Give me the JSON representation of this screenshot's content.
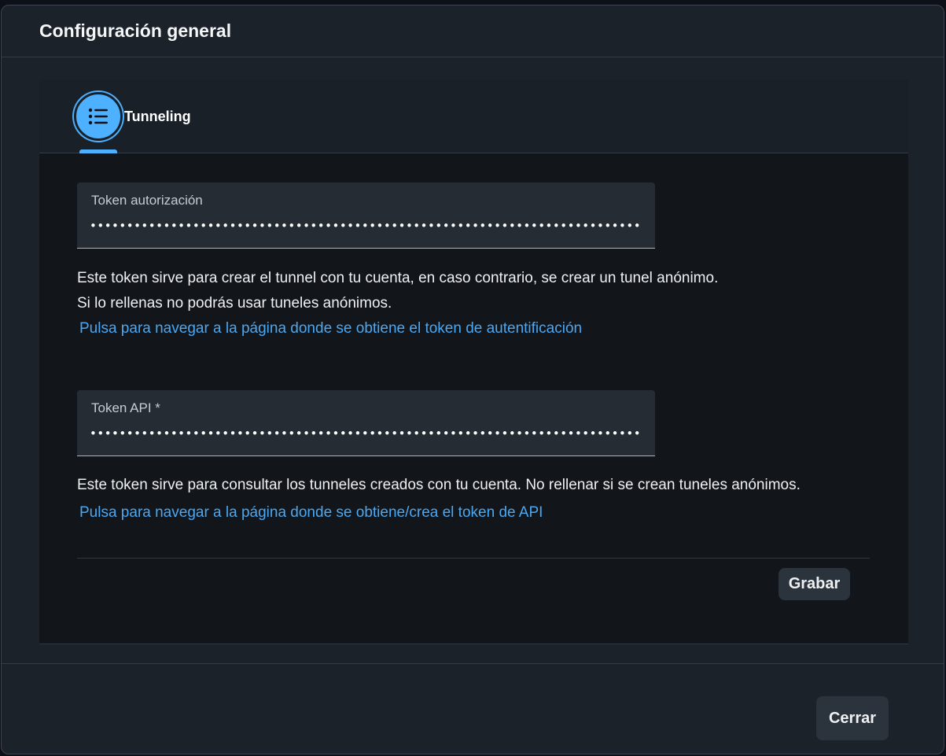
{
  "dialog": {
    "title": "Configuración general"
  },
  "tabs": [
    {
      "label": "Tunneling",
      "icon": "list-icon",
      "selected": true
    }
  ],
  "fields": {
    "auth_token": {
      "label": "Token autorización",
      "value": "••••••••••••••••••••••••••••••••••••••••••••••••••••••••••••••••••••••••••••••••"
    },
    "api_token": {
      "label": "Token API *",
      "value": "••••••••••••••••••••••••••••••••••••••••••••••••••••••••••••••••••••••••••••••••"
    }
  },
  "help": {
    "auth_line1": "Este token sirve para crear el tunnel con tu cuenta, en caso contrario, se crear un tunel anónimo.",
    "auth_line2": "Si lo rellenas no podrás usar tuneles anónimos.",
    "auth_link": "Pulsa para navegar a la página donde se obtiene el token de autentificación",
    "api_line1": "Este token sirve para consultar los tunneles creados con tu cuenta. No rellenar si se crean tuneles anónimos.",
    "api_link": "Pulsa para navegar a la página donde se obtiene/crea el token de API"
  },
  "buttons": {
    "save": "Grabar",
    "close": "Cerrar"
  },
  "colors": {
    "accent": "#4db1ff",
    "link": "#4aa7f2",
    "background": "#1c222a"
  }
}
